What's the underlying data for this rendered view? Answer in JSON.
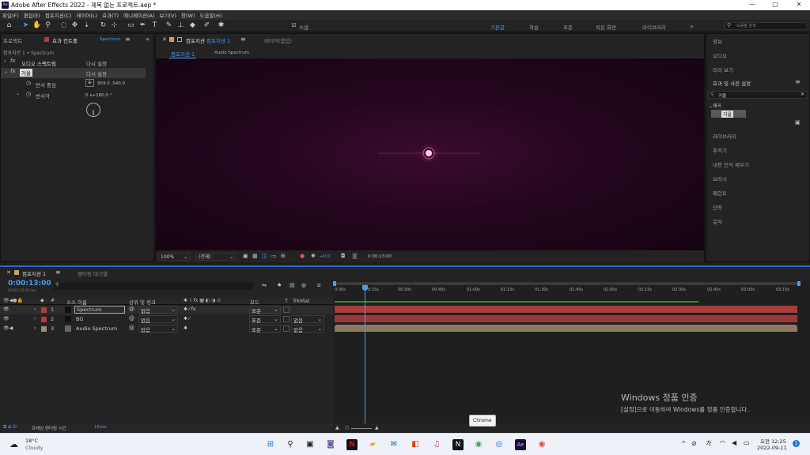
{
  "window": {
    "title": "Adobe After Effects 2022 - 제목 없는 프로젝트.aep *",
    "app_badge": "Ae",
    "buttons": {
      "minimize": "—",
      "maximize": "▢",
      "close": "✕"
    }
  },
  "menu": [
    "파일(F)",
    "편집(E)",
    "컴포지션(C)",
    "레이어(L)",
    "효과(T)",
    "애니메이션(A)",
    "보기(V)",
    "창(W)",
    "도움말(H)"
  ],
  "toolbar": {
    "snap_label": "스냅",
    "workspaces": [
      {
        "label": "기본값",
        "active": true
      },
      {
        "label": "학습",
        "active": false
      },
      {
        "label": "표준",
        "active": false
      },
      {
        "label": "작은 화면",
        "active": false
      },
      {
        "label": "라이브러리",
        "active": false
      }
    ],
    "more": "»",
    "search_placeholder": "도움말 검색"
  },
  "left_panel": {
    "tab_project": "프로젝트",
    "tab_effects": "효과 컨트롤",
    "tab_effects_layer": "Spectrum",
    "breadcrumb": "컴포지션 1 • Spectrum",
    "rows": [
      {
        "fx": "fx",
        "label": "오디오 스펙트럼",
        "reset": "다시 설정"
      },
      {
        "fx": "fx",
        "label": "거울",
        "reset": "다시 설정"
      }
    ],
    "props": [
      {
        "label": "반사 중심",
        "value": "959.0 ,540.0"
      },
      {
        "label": "반사각",
        "value": "0 x+180.0 °"
      }
    ]
  },
  "comp_panel": {
    "tab_label": "컴포지션",
    "tab_name": "컴포지션 1",
    "layer_tab": "레이어(없음)",
    "subtabs": [
      "컴포지션 1",
      "Audio Spectrum"
    ],
    "zoom": "100%",
    "resolution": "(전체)",
    "exposure": "+0.0",
    "timecode": "0:00:13:00"
  },
  "right_panel": {
    "items": [
      "정보",
      "오디오",
      "미리 보기",
      "효과 및 사전 설정"
    ],
    "search_value": "거울",
    "category": "왜곡",
    "result": "거울",
    "items2": [
      "라이브러리",
      "추적기",
      "내용 인식 채우기",
      "브러시",
      "페인트",
      "단락",
      "문자"
    ]
  },
  "timeline": {
    "tab_label": "컴포지션 1",
    "render_queue": "렌더링 대기열",
    "timecode": "0:00:13:00",
    "timecode_sub": "00325 (25.00 fps)",
    "search_placeholder": "",
    "col_source": "소스 이름",
    "col_parent": "상위 및 링크",
    "col_mode": "모드",
    "col_t": "T",
    "col_trkmat": "TrkMat",
    "layers": [
      {
        "num": "1",
        "name": "Spectrum",
        "parent": "없음",
        "mode": "표준",
        "trkmat": "",
        "color": "#b53a3a"
      },
      {
        "num": "2",
        "name": "BG",
        "parent": "없음",
        "mode": "표준",
        "trkmat": "없음",
        "color": "#b53a3a"
      },
      {
        "num": "3",
        "name": "Audio Spectrum",
        "parent": "없음",
        "mode": "표준",
        "trkmat": "없음",
        "color": "#a38a70"
      }
    ],
    "ruler": [
      "0:00s",
      "0:15s",
      "00:30s",
      "00:45s",
      "01:00s",
      "01:15s",
      "01:30s",
      "01:45s",
      "02:00s",
      "02:15s",
      "02:30s",
      "02:45s",
      "03:00s",
      "03:15s"
    ],
    "footer_label": "프레임 렌더링 시간",
    "footer_value": "15ms",
    "tooltip": "Chrome"
  },
  "watermark": {
    "title": "Windows 정품 인증",
    "sub": "[설정]으로 이동하여 Windows를 정품 인증합니다."
  },
  "taskbar": {
    "weather_temp": "18°C",
    "weather_text": "Cloudy",
    "ime": "가",
    "time": "오전 12:25",
    "date": "2022-09-11"
  },
  "colors": {
    "accent": "#4b9cf5",
    "timeline_border": "#2d67c9",
    "layer_red": "#b53a3a",
    "layer_tan": "#a38a70",
    "comp_bg": "#24061c"
  }
}
